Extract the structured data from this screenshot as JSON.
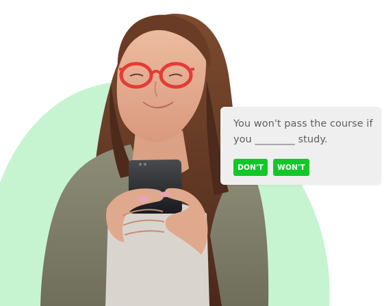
{
  "quiz": {
    "question": "You won't pass the course if you ________ study.",
    "answers": [
      "DON'T",
      "WON'T"
    ]
  },
  "colors": {
    "blob": "#c6f4d0",
    "card": "#efefef",
    "button": "#12c828"
  }
}
